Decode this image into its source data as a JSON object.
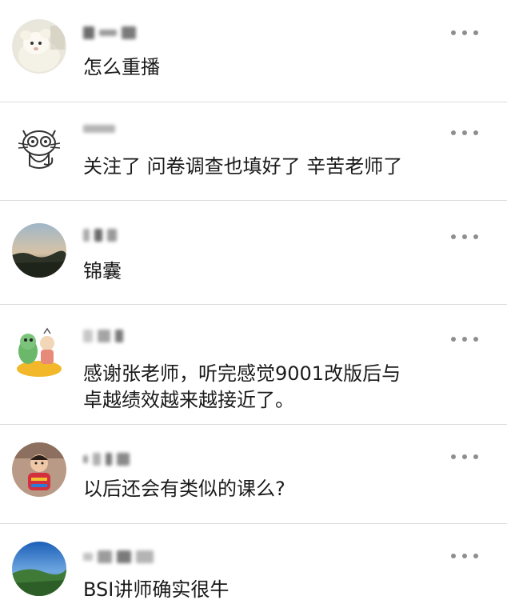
{
  "comments": [
    {
      "text": "怎么重播",
      "avatar": "cartoon-plush-avatar"
    },
    {
      "text": "关注了 问卷调查也填好了 辛苦老师了",
      "avatar": "cartoon-cat-avatar"
    },
    {
      "text": "锦囊",
      "avatar": "landscape-sunset-avatar"
    },
    {
      "text": "感谢张老师，听完感觉9001改版后与\n卓越绩效越来越接近了。",
      "avatar": "cartoon-characters-avatar"
    },
    {
      "text": "以后还会有类似的课么?",
      "avatar": "child-photo-avatar"
    },
    {
      "text": "BSI讲师确实很牛",
      "avatar": "landscape-sky-avatar"
    }
  ],
  "colors": {
    "divider": "#dcdcdc",
    "text": "#1a1a1a",
    "more_dots": "#8e8e8e"
  }
}
